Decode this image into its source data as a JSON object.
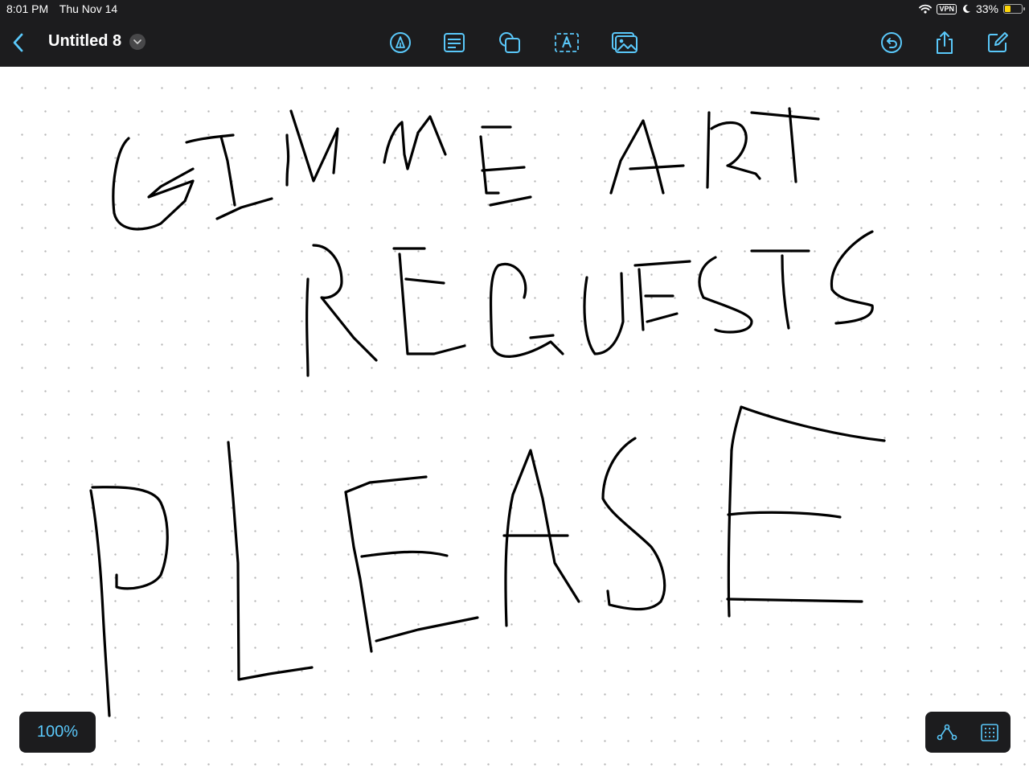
{
  "status_bar": {
    "time": "8:01 PM",
    "date": "Thu Nov 14",
    "vpn": "VPN",
    "battery": "33%",
    "battery_level": 0.33
  },
  "toolbar": {
    "title": "Untitled 8",
    "icons": [
      "back-chevron-icon",
      "title-chevron-icon",
      "markup-pen-icon",
      "text-box-icon",
      "shapes-icon",
      "text-icon",
      "media-icon",
      "undo-icon",
      "share-icon",
      "compose-icon"
    ]
  },
  "canvas": {
    "grid": "dotted",
    "handwriting_lines": [
      "GIMME ART",
      "REQUESTS",
      "PLEASE"
    ]
  },
  "bottom": {
    "zoom": "100%"
  },
  "colors": {
    "accent": "#5ac8fa",
    "bar_background": "#1c1c1e",
    "ink": "#000000",
    "battery_fill": "#ffd60a"
  }
}
